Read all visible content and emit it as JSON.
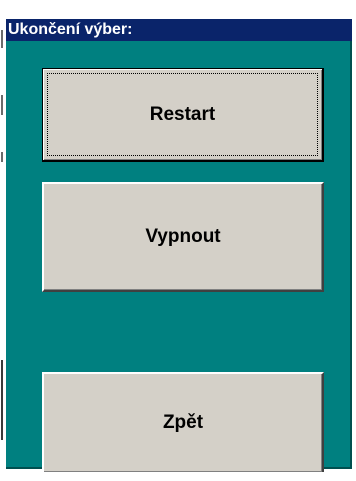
{
  "window": {
    "title": "Ukončení výber:"
  },
  "buttons": {
    "restart": "Restart",
    "vypnout": "Vypnout",
    "zpet": "Zpět"
  },
  "colors": {
    "background": "#008080",
    "titlebar": "#0a246a",
    "button_face": "#d4d0c8"
  }
}
